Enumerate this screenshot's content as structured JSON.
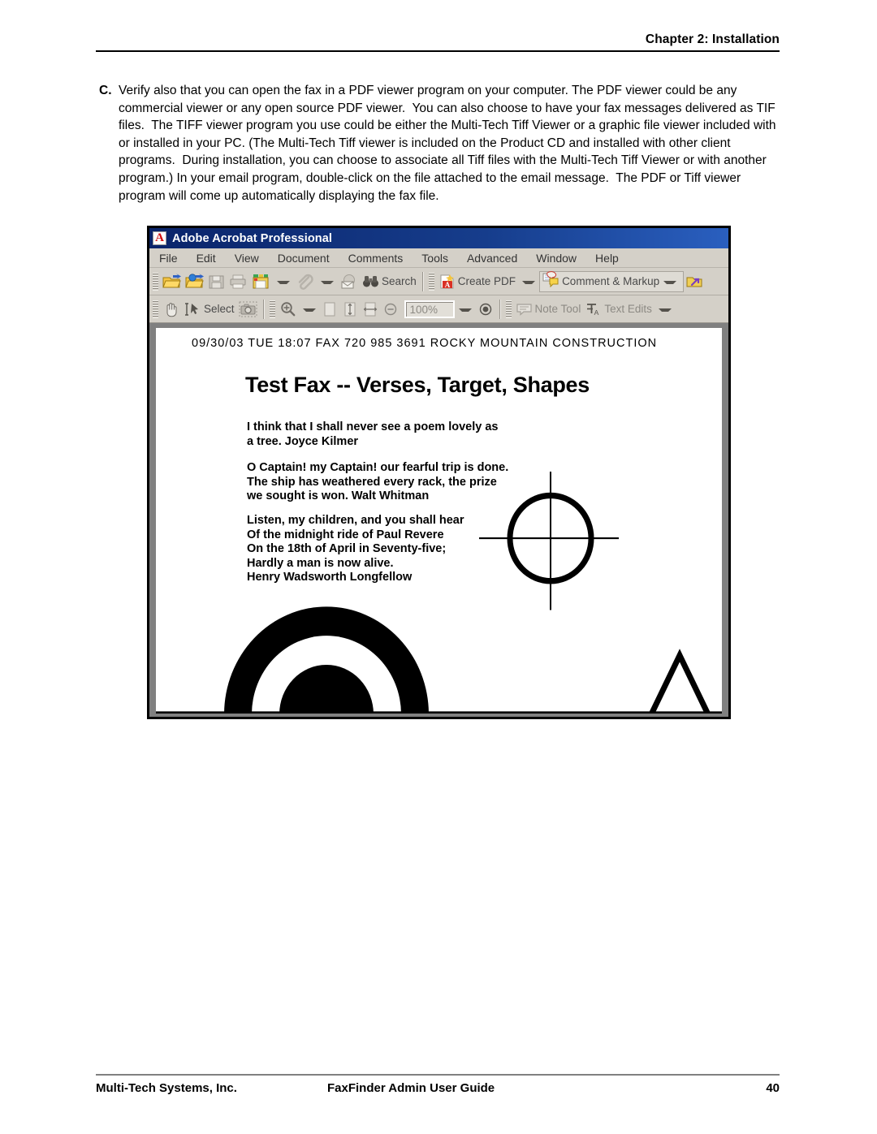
{
  "page": {
    "header_text": "Chapter 2: Installation",
    "footer": {
      "company": "Multi-Tech Systems, Inc.",
      "guide": "FaxFinder Admin User Guide",
      "page_number": "40"
    }
  },
  "instruction": {
    "marker": "C.",
    "text": "Verify also that you can open the fax in a PDF viewer program on your computer. The PDF viewer could be any commercial viewer or any open source PDF viewer.  You can also choose to have your fax messages delivered as TIF files.  The TIFF viewer program you use could be either the Multi-Tech Tiff Viewer or a graphic file viewer included with or installed in your PC. (The Multi-Tech Tiff viewer is included on the Product CD and installed with other client programs.  During installation, you can choose to associate all Tiff files with the Multi-Tech Tiff Viewer or with another program.) In your email program, double-click on the file attached to the email message.  The PDF or Tiff viewer program will come up automatically displaying the fax file."
  },
  "acrobat_window": {
    "title": "Adobe Acrobat Professional",
    "title_icon": "acrobat-icon",
    "titlebar_color": "#0a246a",
    "chrome_color": "#d4d0c8",
    "menus": [
      "File",
      "Edit",
      "View",
      "Document",
      "Comments",
      "Tools",
      "Advanced",
      "Window",
      "Help"
    ],
    "toolbar_row1": [
      {
        "name": "open-file-button",
        "icon": "open-folder-icon",
        "label": ""
      },
      {
        "name": "open-web-pdf-button",
        "icon": "folder-globe-icon",
        "label": ""
      },
      {
        "name": "save-button",
        "icon": "floppy-disk-icon",
        "label": ""
      },
      {
        "name": "print-button",
        "icon": "printer-icon",
        "label": ""
      },
      {
        "name": "organizer-button",
        "icon": "organizer-icon",
        "label": "",
        "has_caret": true
      },
      {
        "name": "attach-file-button",
        "icon": "paperclip-icon",
        "label": "",
        "has_caret": true
      },
      {
        "name": "email-button",
        "icon": "envelope-icon",
        "label": ""
      },
      {
        "name": "search-button",
        "icon": "binoculars-icon",
        "label": "Search"
      },
      {
        "name": "create-pdf-button",
        "icon": "create-pdf-icon",
        "label": "Create PDF",
        "has_caret": true
      },
      {
        "name": "comment-markup-button",
        "icon": "comment-markup-icon",
        "label": "Comment & Markup",
        "has_caret": true
      },
      {
        "name": "send-for-review-button",
        "icon": "send-review-icon",
        "label": ""
      }
    ],
    "toolbar_row2": [
      {
        "name": "hand-tool-button",
        "icon": "hand-icon",
        "label": ""
      },
      {
        "name": "select-tool-button",
        "icon": "select-cursor-icon",
        "label": "Select"
      },
      {
        "name": "snapshot-button",
        "icon": "camera-icon",
        "label": ""
      },
      {
        "name": "zoom-in-tool-button",
        "icon": "magnifier-plus-icon",
        "label": "",
        "has_caret": true
      },
      {
        "name": "actual-size-button",
        "icon": "page-icon",
        "label": ""
      },
      {
        "name": "fit-page-button",
        "icon": "fit-page-icon",
        "label": ""
      },
      {
        "name": "fit-width-button",
        "icon": "fit-width-icon",
        "label": ""
      },
      {
        "name": "zoom-out-button",
        "icon": "zoom-out-icon",
        "label": ""
      },
      {
        "name": "zoom-level-input",
        "icon": "",
        "label": "100%"
      },
      {
        "name": "zoom-level-dropdown",
        "icon": "chevron-down-icon",
        "label": ""
      },
      {
        "name": "zoom-in-button",
        "icon": "zoom-in-icon",
        "label": ""
      },
      {
        "name": "note-tool-button",
        "icon": "sticky-note-icon",
        "label": "Note Tool"
      },
      {
        "name": "text-edits-button",
        "icon": "text-edits-icon",
        "label": "Text Edits",
        "has_caret": true
      }
    ],
    "zoom_level": "100%",
    "search_label": "Search",
    "create_pdf_label": "Create PDF",
    "comment_markup_label": "Comment & Markup",
    "select_label": "Select",
    "note_tool_label": "Note Tool",
    "text_edits_label": "Text Edits"
  },
  "fax_document": {
    "transmission_header": "09/30/03   TUE  18:07   FAX  720  985  3691      ROCKY  MOUNTAIN  CONSTRUCTION",
    "title": "Test Fax -- Verses, Target, Shapes",
    "verses": [
      "I think that I shall never see a poem lovely as\na tree. Joyce Kilmer",
      "O Captain! my Captain! our fearful trip is done.\nThe ship has weathered every rack, the prize\nwe sought is won. Walt Whitman",
      "Listen, my children, and you shall hear\nOf the midnight ride of Paul Revere\nOn the 18th of April in Seventy-five;\nHardly a man is now alive.\nHenry Wadsworth Longfellow"
    ],
    "shapes": [
      {
        "name": "target-crosshair",
        "type": "circle-with-crosshair"
      },
      {
        "name": "concentric-arcs",
        "type": "filled-half-rings"
      },
      {
        "name": "triangle-outline",
        "type": "triangle"
      }
    ]
  }
}
